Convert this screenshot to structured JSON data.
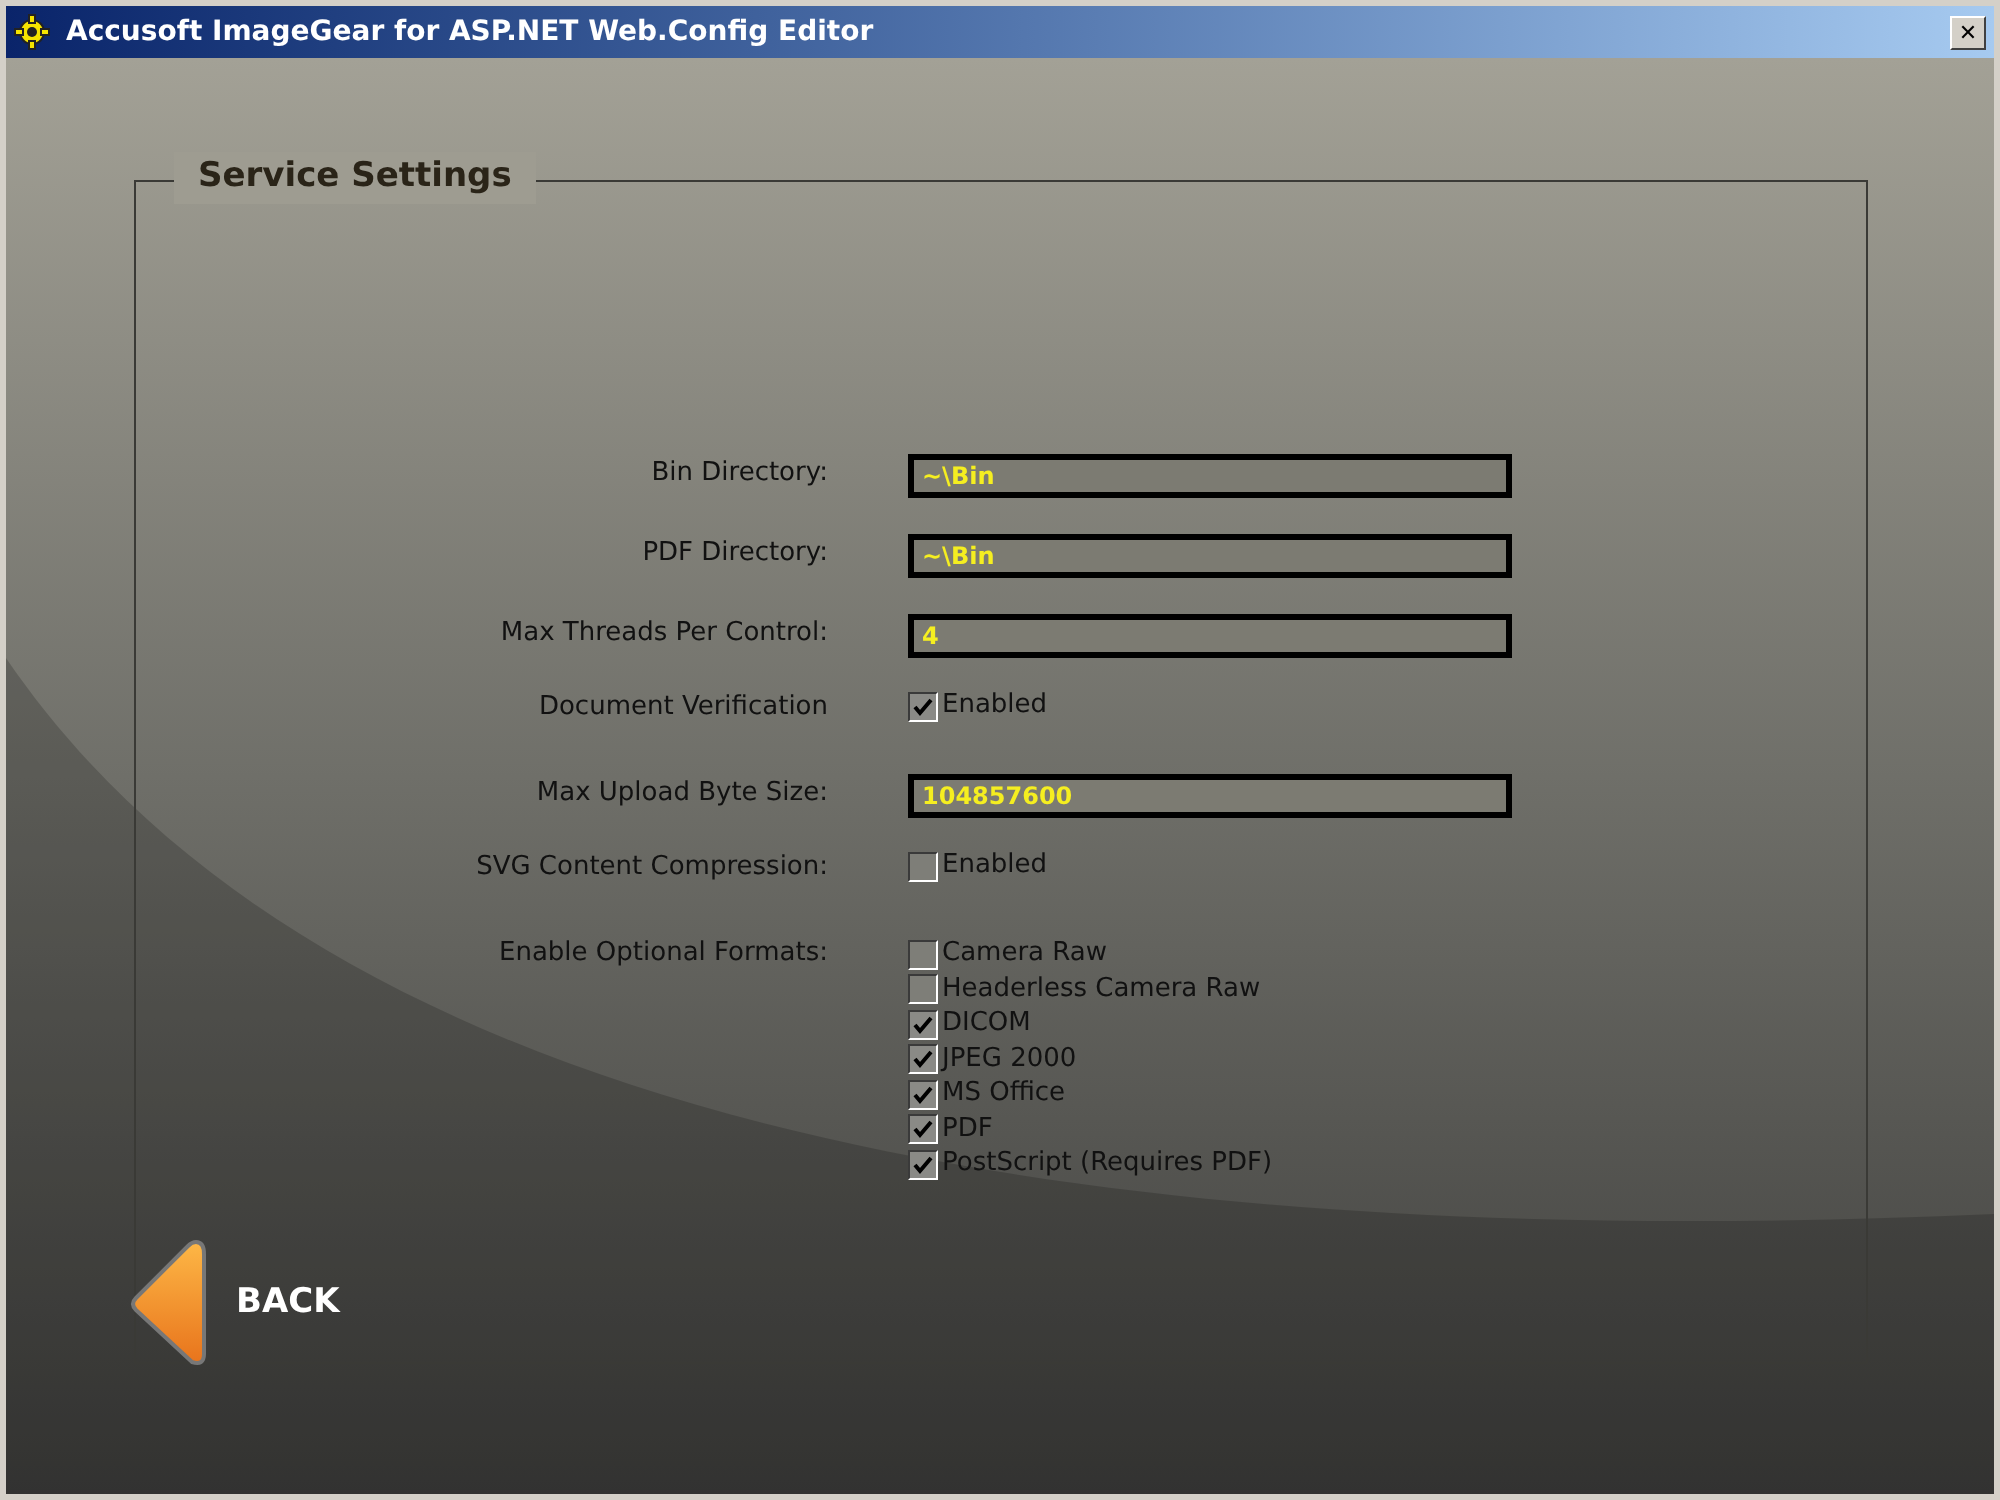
{
  "window": {
    "title": "Accusoft ImageGear for ASP.NET Web.Config Editor",
    "close": "✕"
  },
  "section": {
    "title": "Service Settings"
  },
  "settings": [
    {
      "kind": "text",
      "label": "Bin Directory:",
      "value": "~\\Bin"
    },
    {
      "kind": "text",
      "label": "PDF Directory:",
      "value": "~\\Bin"
    },
    {
      "kind": "text",
      "label": "Max Threads Per Control:",
      "value": "4"
    },
    {
      "kind": "checkbox",
      "label": "Document Verification",
      "option": "Enabled",
      "checked": true
    },
    {
      "kind": "text",
      "label": "Max Upload Byte Size:",
      "value": "104857600"
    },
    {
      "kind": "checkbox",
      "label": "SVG Content Compression:",
      "option": "Enabled",
      "checked": false
    },
    {
      "kind": "checklist",
      "label": "Enable Optional Formats:",
      "options": [
        {
          "label": "Camera Raw",
          "checked": false
        },
        {
          "label": "Headerless Camera Raw",
          "checked": false
        },
        {
          "label": "DICOM",
          "checked": true
        },
        {
          "label": "JPEG 2000",
          "checked": true
        },
        {
          "label": "MS Office",
          "checked": true
        },
        {
          "label": "PDF",
          "checked": true
        },
        {
          "label": "PostScript (Requires PDF)",
          "checked": true
        }
      ]
    }
  ],
  "back_button": {
    "label": "BACK"
  }
}
